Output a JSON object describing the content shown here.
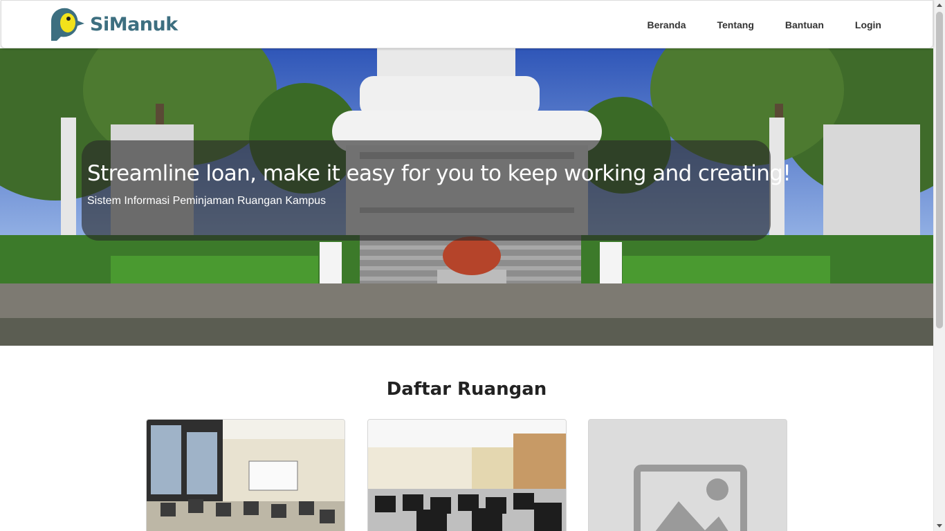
{
  "brand": {
    "name": "SiManuk",
    "logo_icon": "bird-logo-icon"
  },
  "nav": {
    "items": [
      {
        "label": "Beranda"
      },
      {
        "label": "Tentang"
      },
      {
        "label": "Bantuan"
      },
      {
        "label": "Login"
      }
    ]
  },
  "hero": {
    "title": "Streamline loan, make it easy for you to keep working and creating!",
    "subtitle": "Sistem Informasi Peminjaman Ruangan Kampus"
  },
  "rooms": {
    "title": "Daftar Ruangan",
    "cards": [
      {
        "image": "classroom-photo"
      },
      {
        "image": "computer-lab-photo"
      },
      {
        "image": "placeholder-image-icon"
      }
    ]
  },
  "colors": {
    "brand": "#3d6f80",
    "logo_yellow": "#f2e21b",
    "overlay": "#282828"
  }
}
